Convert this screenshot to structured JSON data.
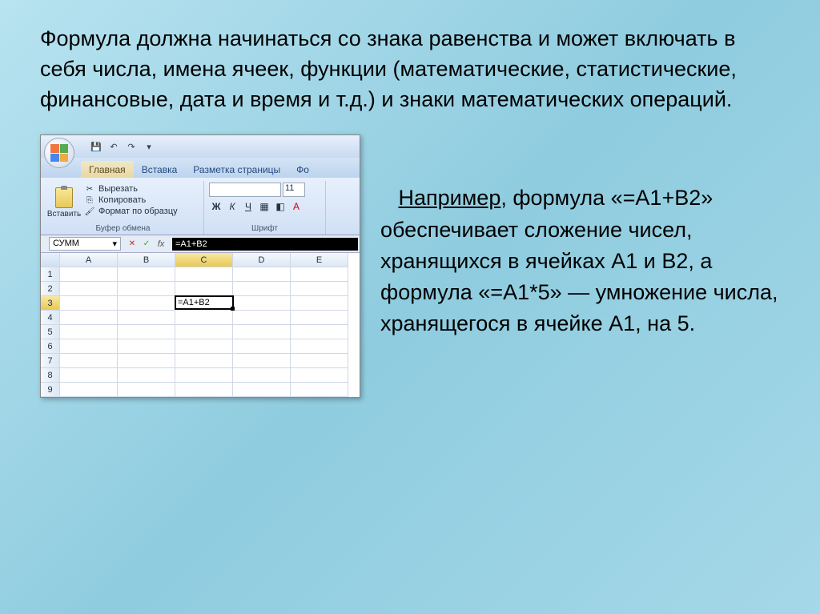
{
  "main_text": "Формула должна начинаться со знака равенства и может включать в себя числа, имена ячеек, функции (математические, статистические, финансовые, дата и время и т.д.) и знаки математических операций.",
  "example": {
    "lead": "Например",
    "rest": ", формула «=A1+B2» обеспечивает сложение чисел, хранящихся в ячейках A1 и B2, а формула «=A1*5» — умножение числа, хранящегося в ячейке A1, на 5."
  },
  "excel": {
    "tabs": {
      "home": "Главная",
      "insert": "Вставка",
      "layout": "Разметка страницы",
      "formulas": "Фо"
    },
    "ribbon": {
      "paste": "Вставить",
      "cut": "Вырезать",
      "copy": "Копировать",
      "format_painter": "Формат по образцу",
      "clipboard_group": "Буфер обмена",
      "font_group": "Шрифт",
      "font_size": "11"
    },
    "name_box": "СУММ",
    "formula": "=A1+B2",
    "cell_content": "=A1+B2",
    "columns": [
      "A",
      "B",
      "C",
      "D",
      "E"
    ],
    "rows": [
      "1",
      "2",
      "3",
      "4",
      "5",
      "6",
      "7",
      "8",
      "9"
    ],
    "active_row": "3",
    "active_col": "C"
  }
}
